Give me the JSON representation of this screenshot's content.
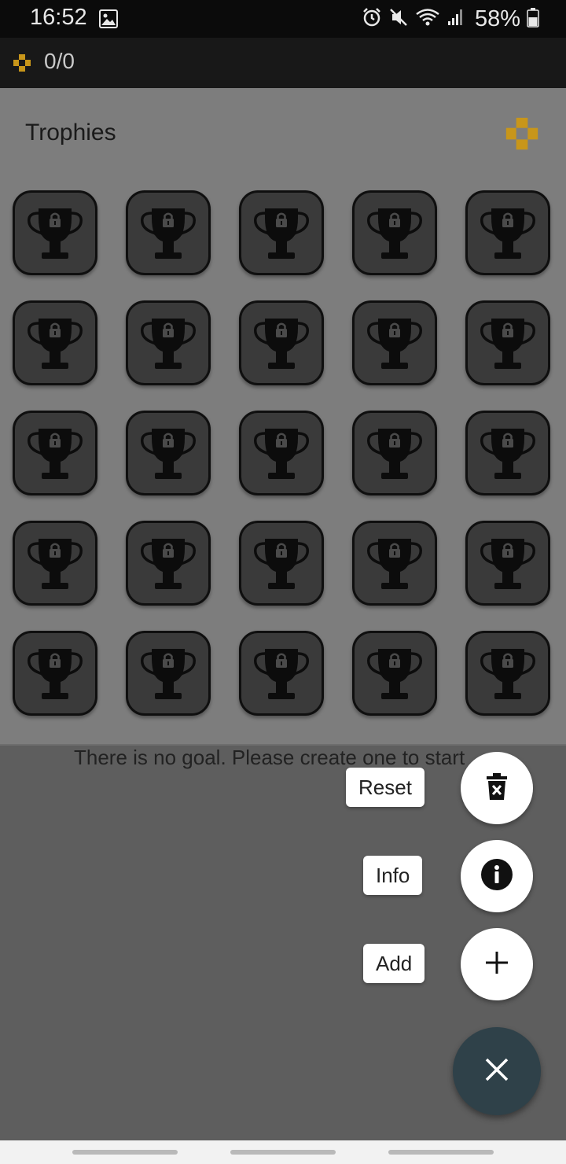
{
  "status_bar": {
    "time": "16:52",
    "battery": "58%"
  },
  "app_bar": {
    "score": "0/0"
  },
  "panel": {
    "title": "Trophies",
    "trophy_count": 25
  },
  "empty_message": "There is no goal. Please create one to start",
  "fab_menu": {
    "reset_label": "Reset",
    "info_label": "Info",
    "add_label": "Add"
  },
  "colors": {
    "accent_gold": "#c8961a",
    "fab_main": "#2f4149",
    "panel_bg": "#7d7d7d",
    "scrim_bg": "#5e5e5e"
  }
}
